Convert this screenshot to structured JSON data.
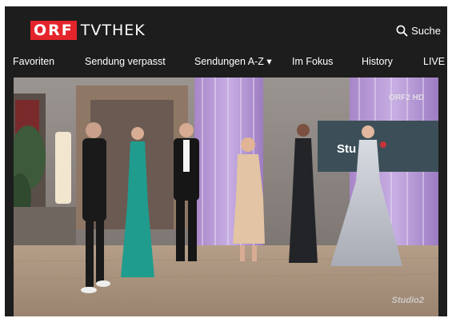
{
  "header": {
    "logo_orf": "ORF",
    "logo_tvthek": "TVTHEK",
    "search_label": "Suche",
    "search_icon": "search-icon"
  },
  "nav": {
    "items": [
      {
        "label": "Favoriten"
      },
      {
        "label": "Sendung verpasst"
      },
      {
        "label": "Sendungen A-Z ▾"
      },
      {
        "label": "Im Fokus"
      },
      {
        "label": "History"
      },
      {
        "label": "LIVE"
      }
    ]
  },
  "player": {
    "channel_logo": "ORF2 HD",
    "studio_logo": "Studio2",
    "screen_text": "Stu"
  },
  "colors": {
    "brand_red": "#e4252b",
    "background": "#1d1d1d"
  }
}
